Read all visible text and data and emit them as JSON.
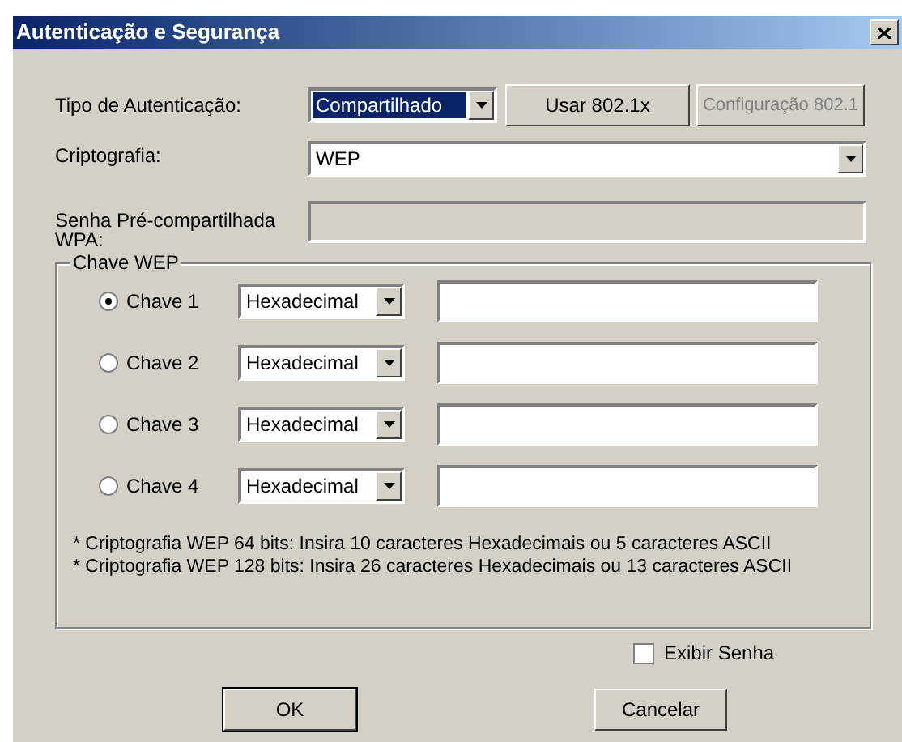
{
  "window": {
    "title": "Autenticação e Segurança"
  },
  "authentication_type": {
    "label": "Tipo de Autenticação:",
    "value": "Compartilhado",
    "focused": true
  },
  "use_8021x_button": {
    "label": "Usar 802.1x",
    "disabled": false
  },
  "config_8021x_button": {
    "label": "Configuração 802.1",
    "disabled": true
  },
  "encryption": {
    "label": "Criptografia:",
    "value": "WEP"
  },
  "wpa_psk": {
    "label_lines": [
      "Senha Pré-compartilhada",
      "WPA:"
    ],
    "disabled": true
  },
  "wep_key_group": {
    "title": "Chave WEP",
    "keys": [
      {
        "label": "Chave 1",
        "selected": true,
        "format": "Hexadecimal"
      },
      {
        "label": "Chave 2",
        "selected": false,
        "format": "Hexadecimal"
      },
      {
        "label": "Chave 3",
        "selected": false,
        "format": "Hexadecimal"
      },
      {
        "label": "Chave 4",
        "selected": false,
        "format": "Hexadecimal"
      }
    ],
    "notes": [
      "* Criptografia WEP 64 bits: Insira 10 caracteres Hexadecimais ou 5 caracteres ASCII",
      "* Criptografia WEP 128 bits: Insira 26 caracteres Hexadecimais ou 13 caracteres ASCII"
    ]
  },
  "show_password": {
    "label": "Exibir Senha",
    "checked": false
  },
  "buttons": [
    {
      "label": "OK",
      "default": true
    },
    {
      "label": "Cancelar",
      "default": false
    }
  ]
}
